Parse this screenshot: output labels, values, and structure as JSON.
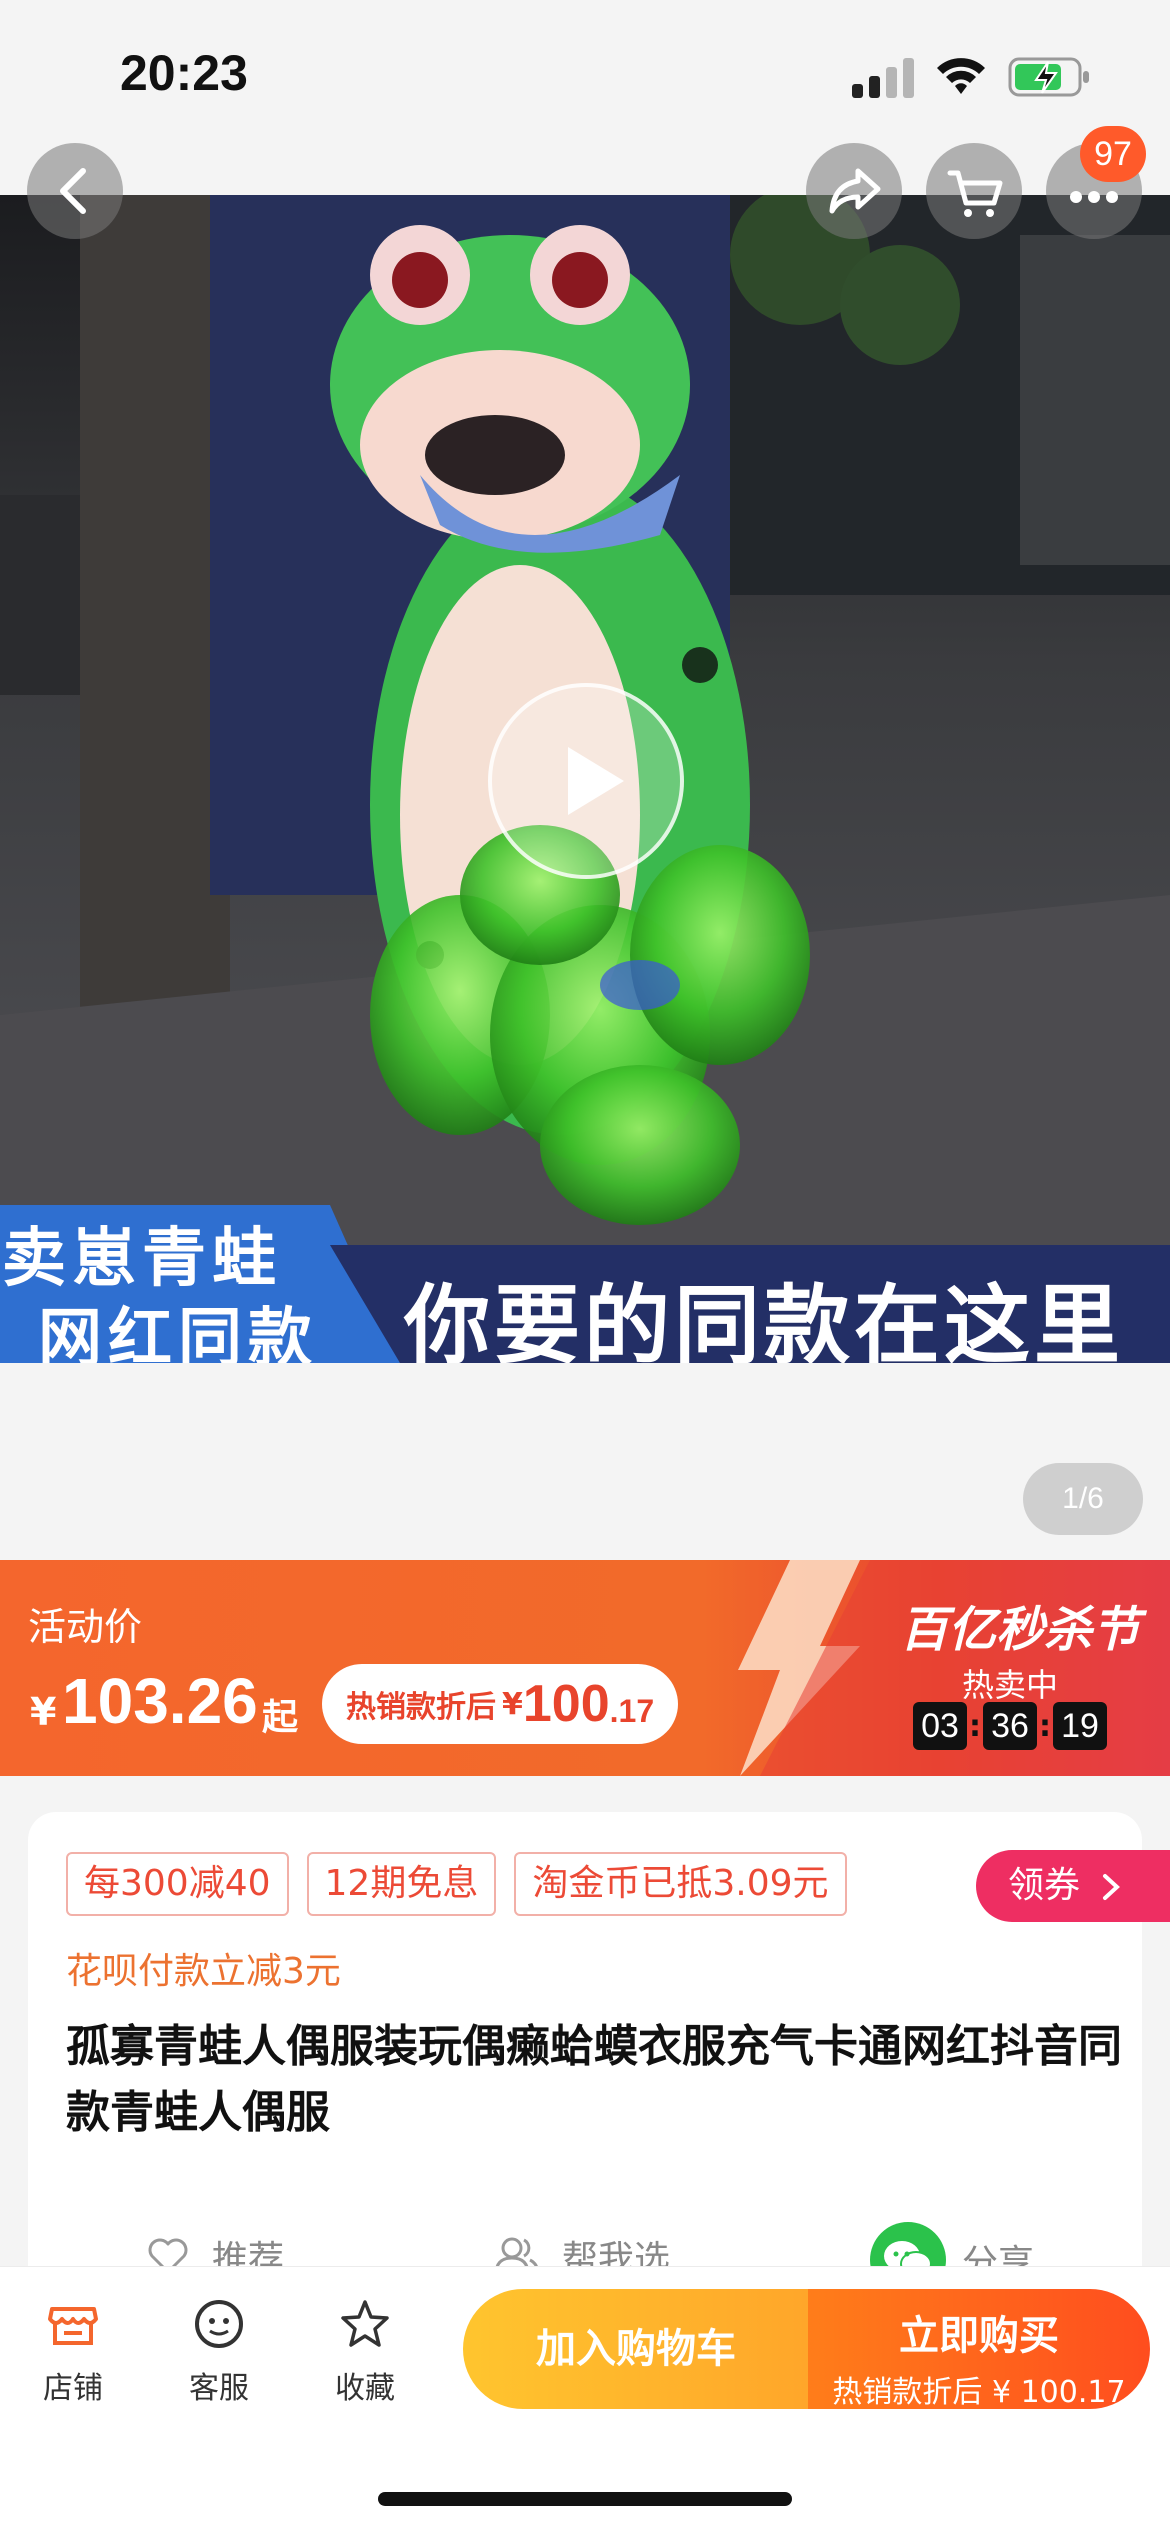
{
  "status_bar": {
    "time": "20:23"
  },
  "header": {
    "cart_badge_count": "97"
  },
  "gallery": {
    "overlay_left_line1": "卖崽青蛙",
    "overlay_left_line2": "网红同款",
    "overlay_right": "你要的同款在这里",
    "page_indicator": "1/6"
  },
  "price_banner": {
    "promo_label": "活动价",
    "currency": "¥",
    "price": "103.26",
    "price_suffix": "起",
    "discount_label": "热销款折后",
    "discount_currency": "¥",
    "discount_price_int": "100",
    "discount_price_dec": ".17",
    "festival_title": "百亿秒杀节",
    "hot_label": "热卖中",
    "countdown": {
      "hours": "03",
      "minutes": "36",
      "seconds": "19"
    }
  },
  "product": {
    "tags": [
      "每300减40",
      "12期免息",
      "淘金币已抵3.09元"
    ],
    "coupon_label": "领券",
    "huabei_note": "花呗付款立减3元",
    "title": "孤寡青蛙人偶服装玩偶癞蛤蟆衣服充气卡通网红抖音同款青蛙人偶服",
    "actions": {
      "recommend": "推荐",
      "help_choose": "帮我选",
      "share": "分享"
    }
  },
  "bottom_bar": {
    "store": "店铺",
    "service": "客服",
    "favorite": "收藏",
    "add_to_cart": "加入购物车",
    "buy_now": "立即购买",
    "buy_now_sub": "热销款折后 ¥ 100.17"
  },
  "colors": {
    "accent": "#f4662d",
    "buy": "#ff5a1f",
    "cart": "#ffb72a",
    "share": "#2bc24b"
  }
}
